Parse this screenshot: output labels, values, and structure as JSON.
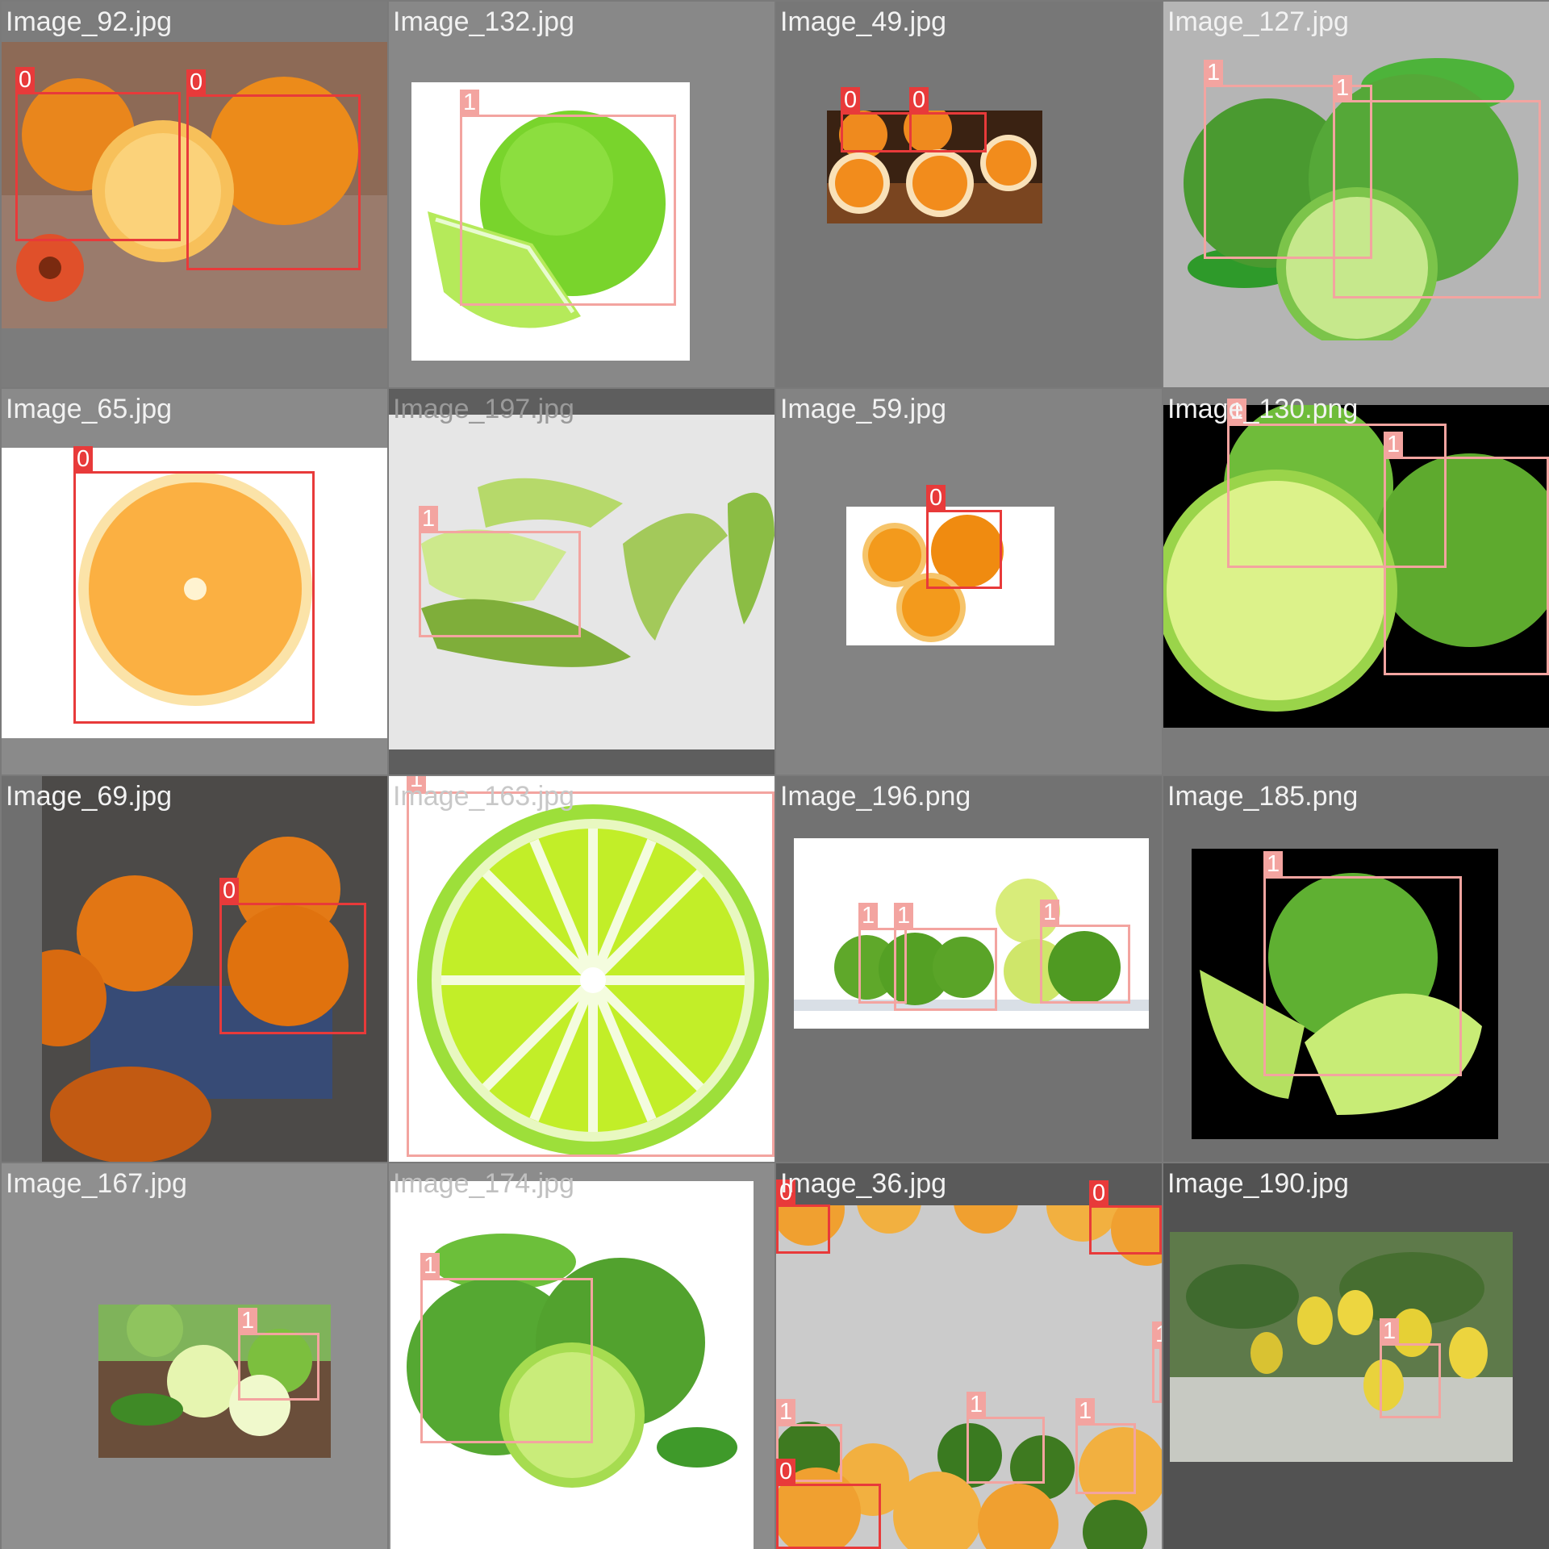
{
  "colors": {
    "class_0": "#e83a3a",
    "class_1": "#f3a4a0",
    "title_text": "#f2f2f2"
  },
  "tiles": [
    {
      "title": "Image_92.jpg",
      "bg": "#7c7c7c",
      "photo": "oranges-wood",
      "boxes": [
        {
          "label": "0",
          "class": 0
        },
        {
          "label": "0",
          "class": 0
        }
      ]
    },
    {
      "title": "Image_132.jpg",
      "bg": "#888888",
      "photo": "lime-white-wedge",
      "boxes": [
        {
          "label": "1",
          "class": 1
        }
      ]
    },
    {
      "title": "Image_49.jpg",
      "bg": "#777777",
      "photo": "orange-halves-dark",
      "boxes": [
        {
          "label": "0",
          "class": 0
        },
        {
          "label": "0",
          "class": 0
        }
      ]
    },
    {
      "title": "Image_127.jpg",
      "bg": "#b5b5b5",
      "photo": "limes-leaves",
      "boxes": [
        {
          "label": "1",
          "class": 1
        },
        {
          "label": "1",
          "class": 1
        }
      ]
    },
    {
      "title": "Image_65.jpg",
      "bg": "#8a8a8a",
      "photo": "orange-slice-white",
      "boxes": [
        {
          "label": "0",
          "class": 0
        }
      ]
    },
    {
      "title": "Image_197.jpg",
      "bg": "#5e5e5e",
      "photo": "lime-peel",
      "boxes": [
        {
          "label": "1",
          "class": 1
        }
      ]
    },
    {
      "title": "Image_59.jpg",
      "bg": "#838383",
      "photo": "orange-halves-white",
      "boxes": [
        {
          "label": "0",
          "class": 0
        }
      ]
    },
    {
      "title": "Image_130.png",
      "bg": "#7b7b7b",
      "photo": "limes-black",
      "boxes": [
        {
          "label": "1",
          "class": 1
        },
        {
          "label": "1",
          "class": 1
        }
      ]
    },
    {
      "title": "Image_69.jpg",
      "bg": "#6f6f6f",
      "photo": "persimmons",
      "boxes": [
        {
          "label": "0",
          "class": 0
        }
      ]
    },
    {
      "title": "Image_163.jpg",
      "bg": "#8a8a8a",
      "photo": "lime-slice-illustration",
      "boxes": [
        {
          "label": "1",
          "class": 1
        }
      ]
    },
    {
      "title": "Image_196.png",
      "bg": "#727272",
      "photo": "limes-water-splash",
      "boxes": [
        {
          "label": "1",
          "class": 1
        },
        {
          "label": "1",
          "class": 1
        },
        {
          "label": "1",
          "class": 1
        }
      ]
    },
    {
      "title": "Image_185.png",
      "bg": "#6f6f6f",
      "photo": "lime-halves-black",
      "boxes": [
        {
          "label": "1",
          "class": 1
        }
      ]
    },
    {
      "title": "Image_167.jpg",
      "bg": "#8f8f8f",
      "photo": "limes-net-wood",
      "boxes": [
        {
          "label": "1",
          "class": 1
        }
      ]
    },
    {
      "title": "Image_174.jpg",
      "bg": "#8c8c8c",
      "photo": "limes-white-blur",
      "boxes": [
        {
          "label": "1",
          "class": 1
        }
      ]
    },
    {
      "title": "Image_36.jpg",
      "bg": "#5a5a5a",
      "photo": "citrus-frame",
      "boxes": [
        {
          "label": "0",
          "class": 0
        },
        {
          "label": "0",
          "class": 0
        },
        {
          "label": "1",
          "class": 1
        },
        {
          "label": "1",
          "class": 1
        },
        {
          "label": "1",
          "class": 1
        },
        {
          "label": "1",
          "class": 1
        },
        {
          "label": "0",
          "class": 0
        }
      ]
    },
    {
      "title": "Image_190.jpg",
      "bg": "#525252",
      "photo": "lemon-tree",
      "boxes": [
        {
          "label": "1",
          "class": 1
        }
      ]
    }
  ]
}
